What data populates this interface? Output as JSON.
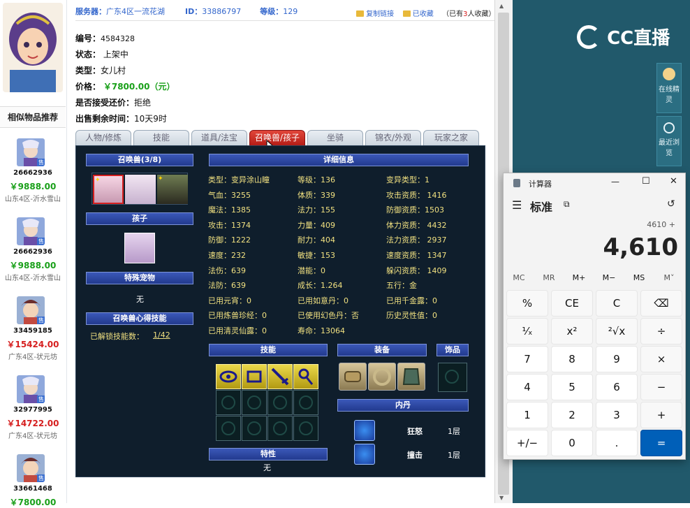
{
  "header": {
    "server_label": "服务器：",
    "server_value": "广东4区一流花湖",
    "id_label": "ID：",
    "id_value": "33886797",
    "level_label": "等级：",
    "level_value": "129",
    "copy_link": "复制链接",
    "favorited": "已收藏",
    "fav_count_prefix": "（已有",
    "fav_count": "3",
    "fav_count_suffix": "人收藏）"
  },
  "info": {
    "number_label": "编号：",
    "number_value": "4584328",
    "status_label": "状态：",
    "status_value": "上架中",
    "type_label": "类型：",
    "type_value": "女儿村",
    "price_label": "价格：",
    "price_value": "￥7800.00（元）",
    "bargain_label": "是否接受还价：",
    "bargain_value": "拒绝",
    "remaining_label": "出售剩余时间：",
    "remaining_value": "10天9时"
  },
  "similar": {
    "title": "相似物品推荐",
    "badge": "售",
    "items": [
      {
        "id": "26662936",
        "price": "￥9888.00",
        "server": "山东4区-沂水雪山",
        "price_color": "#1aa01a"
      },
      {
        "id": "26662936",
        "price": "￥9888.00",
        "server": "山东4区-沂水雪山",
        "price_color": "#1aa01a"
      },
      {
        "id": "33459185",
        "price": "￥15424.00",
        "server": "广东4区-状元坊",
        "price_color": "#d61f1f"
      },
      {
        "id": "32977995",
        "price": "￥14722.00",
        "server": "广东4区-状元坊",
        "price_color": "#d61f1f"
      },
      {
        "id": "33661468",
        "price": "￥7800.00",
        "server": "",
        "price_color": "#1aa01a"
      }
    ]
  },
  "tabs": [
    "人物/修炼",
    "技能",
    "道具/法宝",
    "召唤兽/孩子",
    "坐骑",
    "锦衣/外观",
    "玩家之家"
  ],
  "panel": {
    "summon_header": "召唤兽(3/8)",
    "child_header": "孩子",
    "special_pet_header": "特殊宠物",
    "special_pet_value": "无",
    "skill_insight_header": "召唤兽心得技能",
    "unlocked_label": "已解锁技能数：",
    "unlocked_value": "1/42",
    "detail_header": "详细信息",
    "skills_header": "技能",
    "equip_header": "装备",
    "accessory_header": "饰品",
    "neidan_header": "内丹",
    "trait_header": "特性",
    "trait_value": "无",
    "neidan": [
      {
        "name": "狂怒",
        "level": "1层"
      },
      {
        "name": "撞击",
        "level": "1层"
      }
    ],
    "stats": [
      [
        "类型：变异涂山瞳",
        "等级：136",
        "变异类型：1"
      ],
      [
        "气血：3255",
        "体质：339",
        "攻击资质： 1416"
      ],
      [
        "魔法：1385",
        "法力：155",
        "防御资质：1503"
      ],
      [
        "攻击：1374",
        "力量：409",
        "体力资质： 4432"
      ],
      [
        "防御：1222",
        "耐力：404",
        "法力资质： 2937"
      ],
      [
        "速度：232",
        "敏捷：153",
        "速度资质： 1347"
      ],
      [
        "法伤：639",
        "潜能：0",
        "躲闪资质： 1409"
      ],
      [
        "法防：639",
        "成长：1.264",
        "五行：金"
      ],
      [
        "已用元宵：0",
        "已用如意丹：0",
        "已用千金露：0"
      ],
      [
        "已用炼兽珍经：0",
        "已使用幻色丹：否",
        "历史灵性值：0"
      ],
      [
        "已用清灵仙露：0",
        "寿命：13064",
        ""
      ]
    ]
  },
  "sidebar": {
    "logo_text": "CC直播",
    "online_label": "在线精灵",
    "recent_label": "最近浏览"
  },
  "calculator": {
    "title": "计算器",
    "mode": "标准",
    "expression": "4610 +",
    "display": "4,610",
    "memory": [
      "MC",
      "MR",
      "M+",
      "M−",
      "MS",
      "M˅"
    ],
    "keys": [
      [
        "%",
        "CE",
        "C",
        "⌫"
      ],
      [
        "¹⁄ₓ",
        "x²",
        "²√x",
        "÷"
      ],
      [
        "7",
        "8",
        "9",
        "×"
      ],
      [
        "4",
        "5",
        "6",
        "−"
      ],
      [
        "1",
        "2",
        "3",
        "+"
      ],
      [
        "+/−",
        "0",
        ".",
        "="
      ]
    ],
    "win_minimize": "—",
    "win_maximize": "☐",
    "win_close": "✕"
  }
}
